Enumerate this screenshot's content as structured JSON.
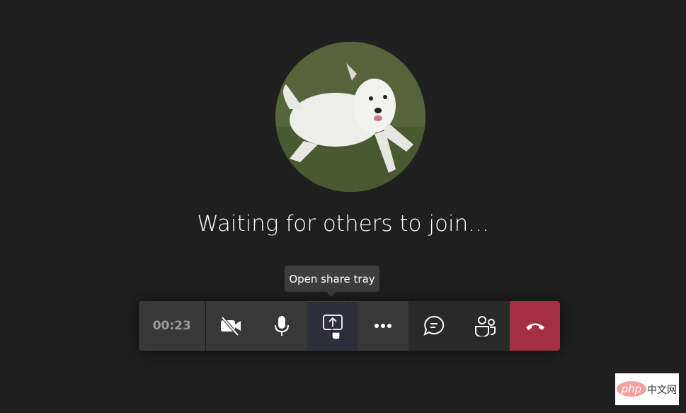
{
  "main": {
    "status_text": "Waiting for others to join...",
    "avatar": "dog-photo-avatar"
  },
  "tooltip": {
    "text": "Open share tray"
  },
  "toolbar": {
    "timer": "00:23",
    "buttons": [
      {
        "name": "camera-off",
        "icon": "video-off-icon"
      },
      {
        "name": "microphone",
        "icon": "microphone-icon"
      },
      {
        "name": "share",
        "icon": "share-screen-icon"
      },
      {
        "name": "more",
        "icon": "more-icon"
      },
      {
        "name": "chat",
        "icon": "chat-icon"
      },
      {
        "name": "participants",
        "icon": "people-icon"
      },
      {
        "name": "leave",
        "icon": "hang-up-icon"
      }
    ],
    "colors": {
      "hangup": "#a4303f",
      "background": "#1f1f1f"
    }
  },
  "watermark": {
    "text": "php中文网"
  }
}
